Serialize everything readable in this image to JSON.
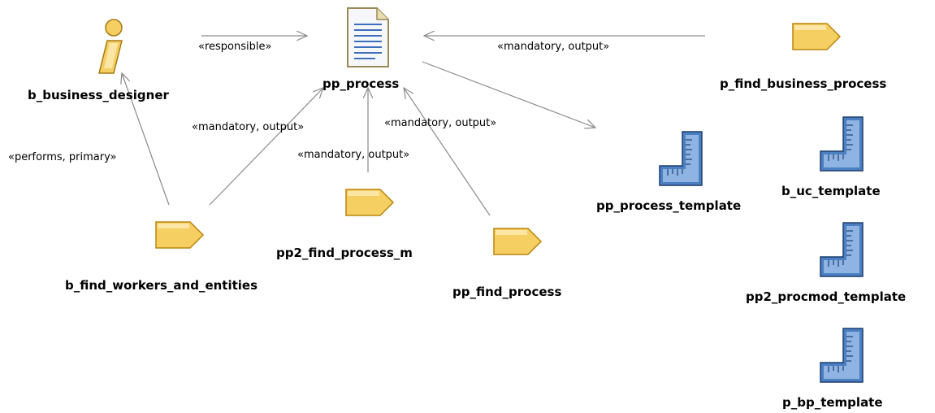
{
  "nodes": {
    "business_designer": "b_business_designer",
    "pp_process": "pp_process",
    "find_business_process": "p_find_business_process",
    "process_template": "pp_process_template",
    "uc_template": "b_uc_template",
    "procmod_template": "pp2_procmod_template",
    "bp_template": "p_bp_template",
    "find_workers": "b_find_workers_and_entities",
    "find_process_m": "pp2_find_process_m",
    "find_process": "pp_find_process"
  },
  "edges": {
    "responsible": "«responsible»",
    "mandatory_output_top": "«mandatory, output»",
    "performs_primary": "«performs, primary»",
    "mandatory_output_left": "«mandatory, output»",
    "mandatory_output_middle": "«mandatory, output»",
    "mandatory_output_right": "«mandatory, output»"
  },
  "colors": {
    "edge": "#8a8a8a",
    "task_fill": "#f6cf63",
    "task_stroke": "#b8860b",
    "template_fill": "#4a7fc1",
    "template_stroke": "#1f3f6f",
    "doc_fill": "#f5f7fb",
    "doc_lines": "#3e6fb8"
  },
  "icons": {
    "role": "person-role-icon",
    "work_product": "document-icon",
    "task": "task-tag-icon",
    "template": "template-ruler-icon"
  }
}
